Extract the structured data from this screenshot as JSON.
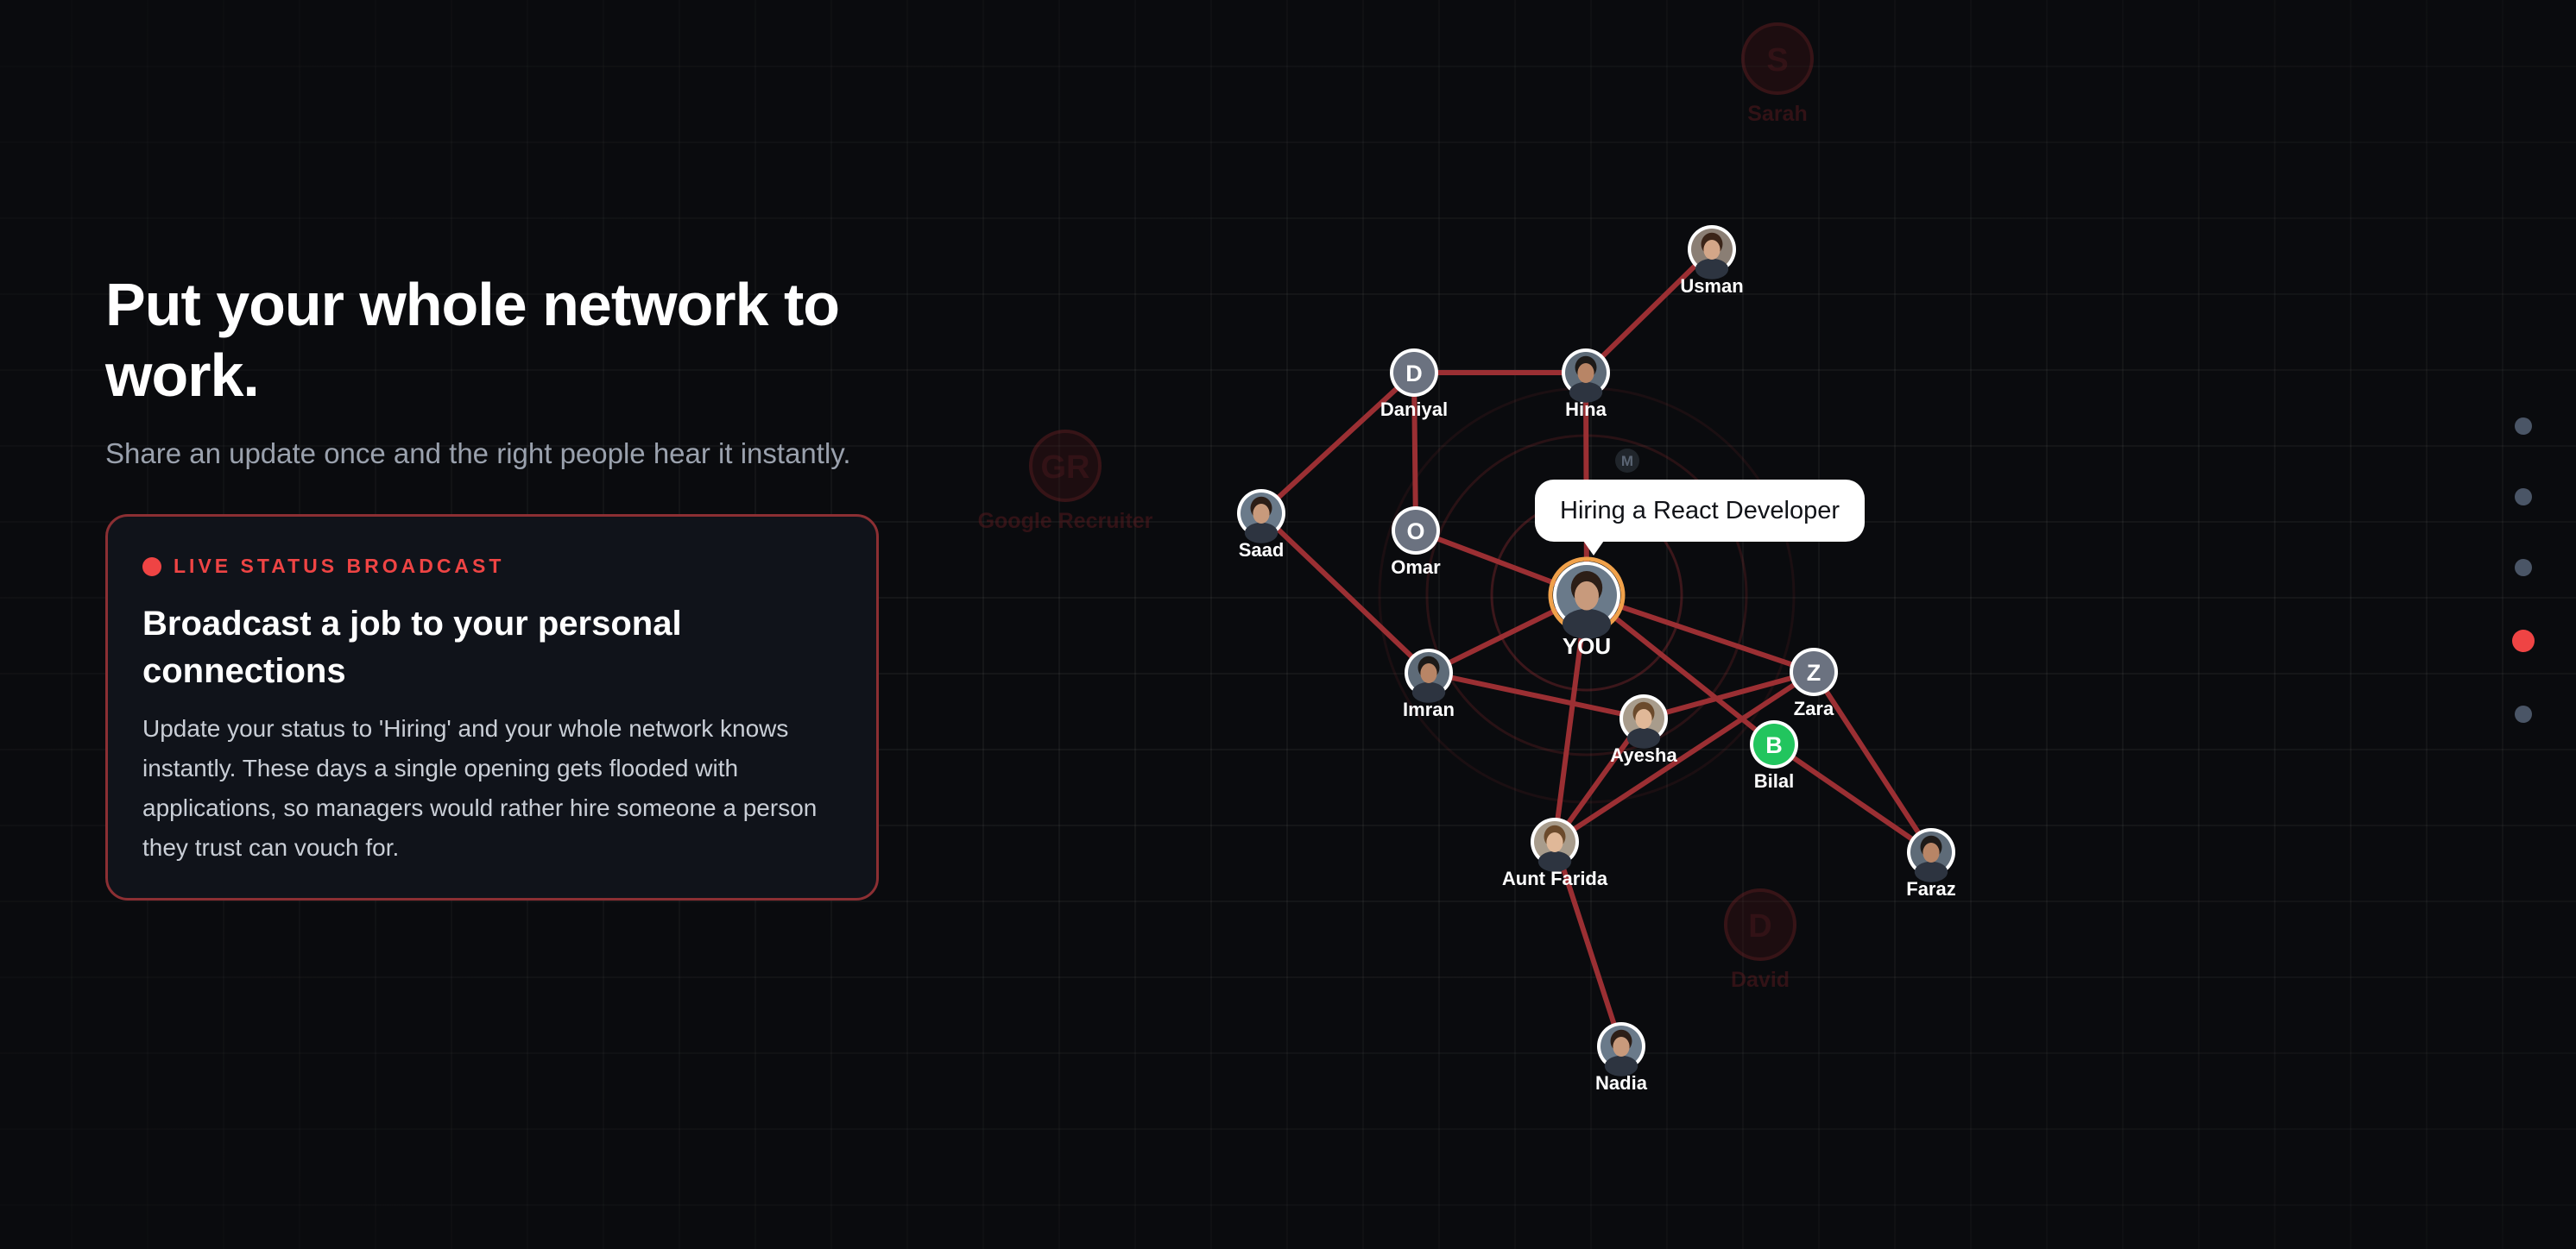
{
  "hero": {
    "headline": "Put your whole network to work.",
    "subhead": "Share an update once and the right people hear it instantly."
  },
  "card": {
    "tag": "LIVE STATUS BROADCAST",
    "title": "Broadcast a job to your personal connections",
    "body": "Update your status to 'Hiring' and your whole network knows instantly. These days a single opening gets flooded with applications, so managers would rather hire someone a person they trust can vouch for."
  },
  "bubble": {
    "text": "Hiring a React Developer"
  },
  "colors": {
    "accent": "#ef4444",
    "edge": "#9b2f33",
    "you_ring": "#f0a14a",
    "initial_node": "#6b7280",
    "bilal": "#22c55e"
  },
  "network": {
    "nodes": [
      {
        "id": "you",
        "label": "YOU",
        "kind": "photo",
        "role": "center"
      },
      {
        "id": "usman",
        "label": "Usman",
        "kind": "photo"
      },
      {
        "id": "hina",
        "label": "Hina",
        "kind": "photo"
      },
      {
        "id": "daniyal",
        "label": "Daniyal",
        "kind": "initial",
        "initial": "D"
      },
      {
        "id": "saad",
        "label": "Saad",
        "kind": "photo"
      },
      {
        "id": "omar",
        "label": "Omar",
        "kind": "initial",
        "initial": "O"
      },
      {
        "id": "imran",
        "label": "Imran",
        "kind": "photo"
      },
      {
        "id": "ayesha",
        "label": "Ayesha",
        "kind": "photo"
      },
      {
        "id": "zara",
        "label": "Zara",
        "kind": "initial",
        "initial": "Z"
      },
      {
        "id": "bilal",
        "label": "Bilal",
        "kind": "initial",
        "initial": "B"
      },
      {
        "id": "faraz",
        "label": "Faraz",
        "kind": "photo"
      },
      {
        "id": "aunt_farida",
        "label": "Aunt Farida",
        "kind": "photo"
      },
      {
        "id": "nadia",
        "label": "Nadia",
        "kind": "photo"
      },
      {
        "id": "m",
        "label": "",
        "kind": "initial",
        "initial": "M",
        "faded": true
      }
    ],
    "ghost_nodes": [
      {
        "id": "sarah",
        "label": "Sarah",
        "initial": "S"
      },
      {
        "id": "google",
        "label": "Google Recruiter",
        "initial": "GR"
      },
      {
        "id": "david",
        "label": "David",
        "initial": "D"
      }
    ],
    "edges": [
      [
        "usman",
        "hina"
      ],
      [
        "hina",
        "daniyal"
      ],
      [
        "hina",
        "you"
      ],
      [
        "daniyal",
        "saad"
      ],
      [
        "daniyal",
        "omar"
      ],
      [
        "omar",
        "you"
      ],
      [
        "saad",
        "imran"
      ],
      [
        "imran",
        "you"
      ],
      [
        "imran",
        "ayesha"
      ],
      [
        "you",
        "zara"
      ],
      [
        "you",
        "aunt_farida"
      ],
      [
        "you",
        "bilal"
      ],
      [
        "ayesha",
        "zara"
      ],
      [
        "ayesha",
        "aunt_farida"
      ],
      [
        "zara",
        "aunt_farida"
      ],
      [
        "zara",
        "faraz"
      ],
      [
        "bilal",
        "faraz"
      ],
      [
        "aunt_farida",
        "nadia"
      ]
    ]
  },
  "side_nav": {
    "count": 5,
    "active": 3
  }
}
